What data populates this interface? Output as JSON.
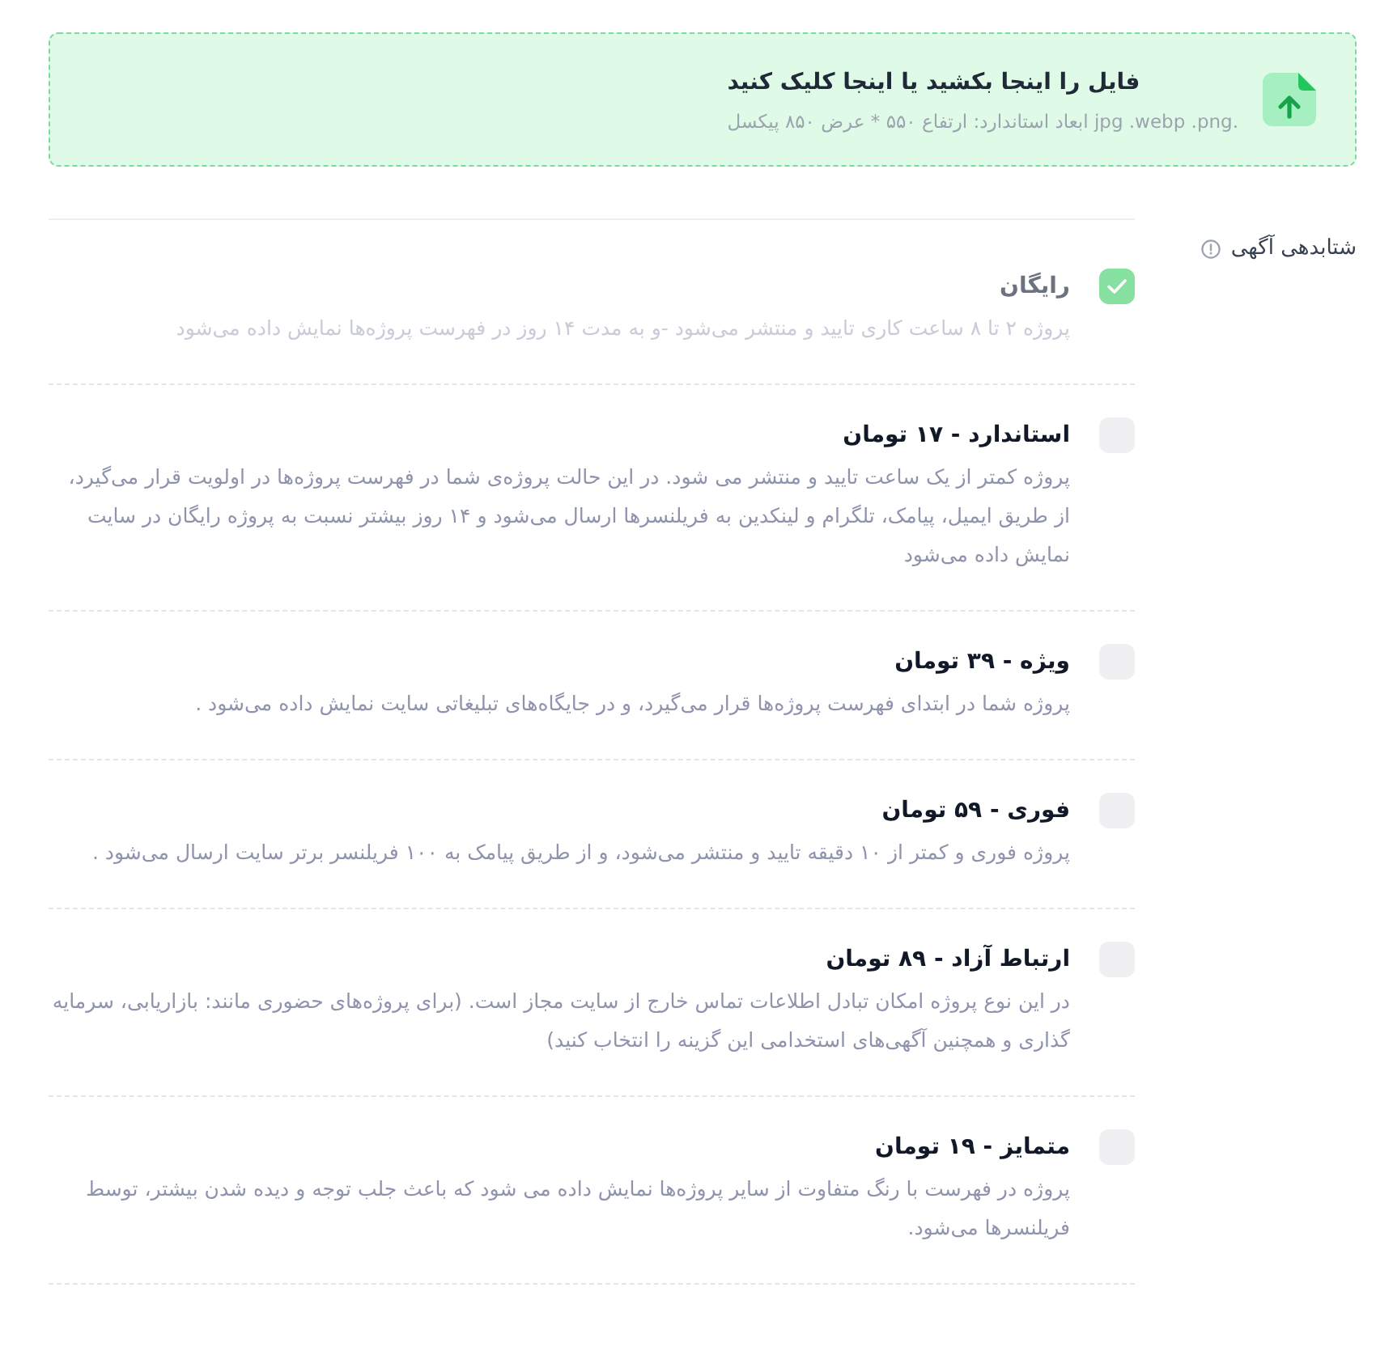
{
  "upload": {
    "title": "فایل را اینجا بکشید یا اینجا کلیک کنید",
    "hint": ".jpg .webp .png ابعاد استاندارد: ارتفاع ۵۵۰ * عرض ۸۵۰ پیکسل"
  },
  "section": {
    "label": "شتابدهی آگهی"
  },
  "options": [
    {
      "title": "رایگان",
      "description": "پروژه ۲ تا ۸ ساعت کاری تایید و منتشر می‌شود -و به مدت ۱۴ روز در فهرست پروژه‌ها نمایش داده می‌شود",
      "checked": true,
      "disabled": true
    },
    {
      "title": "استاندارد - ۱۷ تومان",
      "description": "پروژه کمتر از یک ساعت تایید و منتشر می شود. در این حالت پروژه‌ی شما در فهرست پروژه‌ها در اولویت قرار می‌گیرد، از طریق ایمیل، پیامک، تلگرام و لینکدین به فریلنسرها ارسال می‌شود و ۱۴ روز بیشتر نسبت به پروژه رایگان در سایت نمایش داده می‌شود",
      "checked": false,
      "disabled": false
    },
    {
      "title": "ویژه - ۳۹ تومان",
      "description": "پروژه شما در ابتدای فهرست پروژه‌ها قرار می‌گیرد، و در جایگاه‌های تبلیغاتی سایت نمایش داده می‌شود .",
      "checked": false,
      "disabled": false
    },
    {
      "title": "فوری - ۵۹ تومان",
      "description": "پروژه فوری و کمتر از ۱۰ دقیقه تایید و منتشر می‌شود، و از طریق پیامک به ۱۰۰ فریلنسر برتر سایت ارسال می‌شود .",
      "checked": false,
      "disabled": false
    },
    {
      "title": "ارتباط آزاد - ۸۹ تومان",
      "description": "در این نوع پروژه امکان تبادل اطلاعات تماس خارج از سایت مجاز است. (برای پروژه‌های حضوری مانند: بازاریابی، سرمایه گذاری و همچنین آگهی‌های استخدامی این گزینه را انتخاب کنید)",
      "checked": false,
      "disabled": false
    },
    {
      "title": "متمایز - ۱۹ تومان",
      "description": "پروژه در فهرست با رنگ متفاوت از سایر پروژه‌ها نمایش داده می شود که باعث جلب توجه و دیده شدن بیشتر، توسط فریلنسرها می‌شود.",
      "checked": false,
      "disabled": false
    }
  ]
}
